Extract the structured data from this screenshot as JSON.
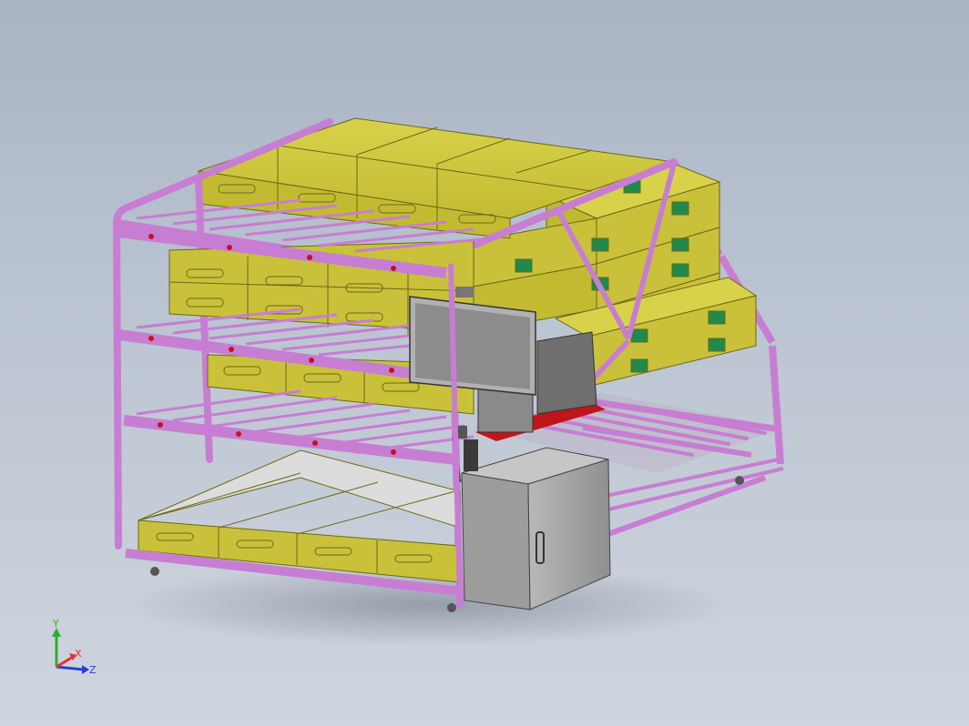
{
  "viewport": {
    "background_top": "#a9b4c4",
    "background_bottom": "#cfd5de"
  },
  "model": {
    "frame_color": "#c77ed2",
    "frame_edge_color": "#7a3c86",
    "box_color": "#c9c13a",
    "box_edge_color": "#6c6818",
    "label_color": "#1f8a4c",
    "empty_tray_color": "#d6d6d6",
    "cabinet_color": "#a9a9a9",
    "monitor_color": "#9a9a9a",
    "accent_red": "#c0151b"
  },
  "triad": {
    "y_label": "Y",
    "x_label": "X",
    "z_label": "Z",
    "y_color": "#2eae2e",
    "x_color": "#d33",
    "z_color": "#2a3fd0"
  }
}
